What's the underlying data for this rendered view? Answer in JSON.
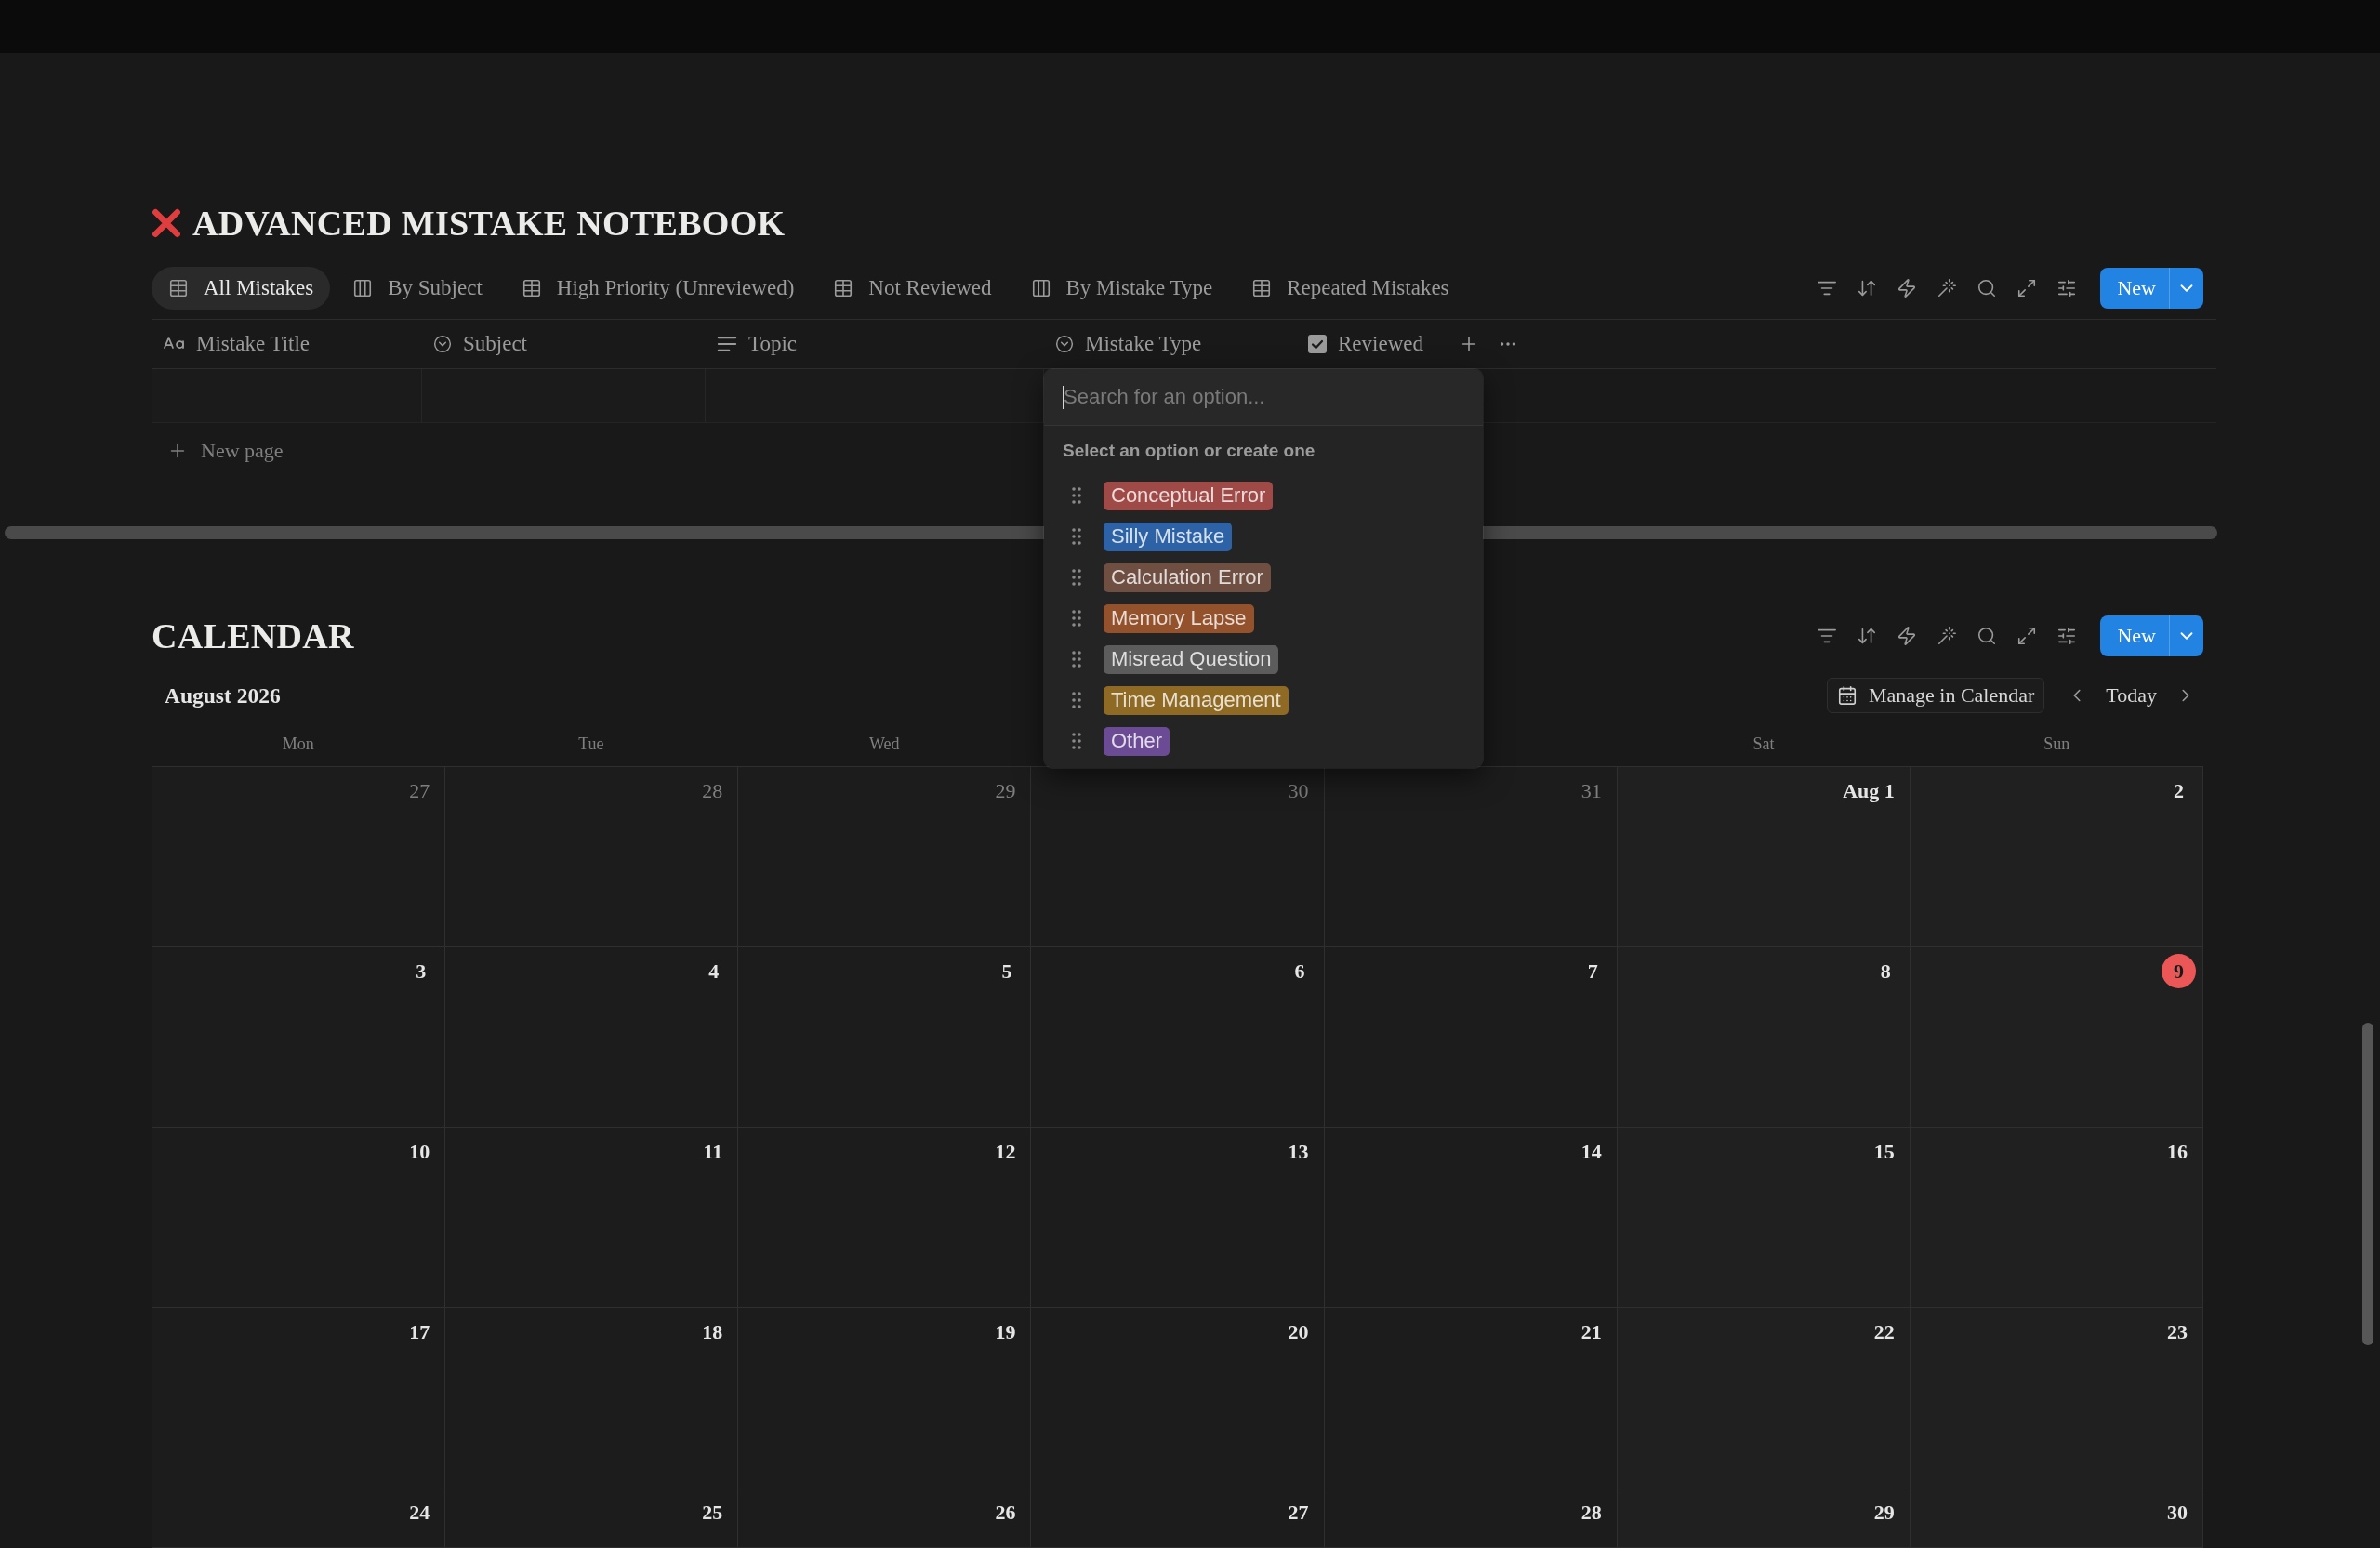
{
  "notebook": {
    "title": "ADVANCED MISTAKE NOTEBOOK",
    "views": [
      {
        "label": "All Mistakes",
        "kind": "table",
        "selected": true
      },
      {
        "label": "By Subject",
        "kind": "board",
        "selected": false
      },
      {
        "label": "High Priority (Unreviewed)",
        "kind": "table",
        "selected": false
      },
      {
        "label": "Not Reviewed",
        "kind": "table",
        "selected": false
      },
      {
        "label": "By Mistake Type",
        "kind": "board",
        "selected": false
      },
      {
        "label": "Repeated Mistakes",
        "kind": "table",
        "selected": false
      }
    ],
    "new_button": "New",
    "columns": [
      {
        "label": "Mistake Title",
        "kind": "title"
      },
      {
        "label": "Subject",
        "kind": "select"
      },
      {
        "label": "Topic",
        "kind": "text"
      },
      {
        "label": "Mistake Type",
        "kind": "select"
      },
      {
        "label": "Reviewed",
        "kind": "checkbox"
      }
    ],
    "new_page": "New page"
  },
  "option_menu": {
    "placeholder": "Search for an option...",
    "hint": "Select an option or create one",
    "options": [
      {
        "label": "Conceptual Error",
        "color": "#9f4a47"
      },
      {
        "label": "Silly Mistake",
        "color": "#2d63a6"
      },
      {
        "label": "Calculation Error",
        "color": "#6f4f42"
      },
      {
        "label": "Memory Lapse",
        "color": "#93512c"
      },
      {
        "label": "Misread Question",
        "color": "#5c5c5c"
      },
      {
        "label": "Time Management",
        "color": "#8e6a24"
      },
      {
        "label": "Other",
        "color": "#6b4b94"
      }
    ]
  },
  "calendar": {
    "title": "CALENDAR",
    "new_button": "New",
    "month": "August 2026",
    "manage_button": "Manage in Calendar",
    "today_button": "Today",
    "weekdays": {
      "mon": "Mon",
      "tue": "Tue",
      "wed": "Wed",
      "sat": "Sat",
      "sun": "Sun"
    },
    "weeks": [
      [
        {
          "label": "27",
          "in_month": false,
          "today": false
        },
        {
          "label": "28",
          "in_month": false,
          "today": false
        },
        {
          "label": "29",
          "in_month": false,
          "today": false
        },
        {
          "label": "30",
          "in_month": false,
          "today": false
        },
        {
          "label": "31",
          "in_month": false,
          "today": false
        },
        {
          "label": "Aug 1",
          "in_month": true,
          "today": false
        },
        {
          "label": "2",
          "in_month": true,
          "today": false
        }
      ],
      [
        {
          "label": "3",
          "in_month": true,
          "today": false
        },
        {
          "label": "4",
          "in_month": true,
          "today": false
        },
        {
          "label": "5",
          "in_month": true,
          "today": false
        },
        {
          "label": "6",
          "in_month": true,
          "today": false
        },
        {
          "label": "7",
          "in_month": true,
          "today": false
        },
        {
          "label": "8",
          "in_month": true,
          "today": false
        },
        {
          "label": "9",
          "in_month": true,
          "today": true
        }
      ],
      [
        {
          "label": "10",
          "in_month": true,
          "today": false
        },
        {
          "label": "11",
          "in_month": true,
          "today": false
        },
        {
          "label": "12",
          "in_month": true,
          "today": false
        },
        {
          "label": "13",
          "in_month": true,
          "today": false
        },
        {
          "label": "14",
          "in_month": true,
          "today": false
        },
        {
          "label": "15",
          "in_month": true,
          "today": false
        },
        {
          "label": "16",
          "in_month": true,
          "today": false
        }
      ],
      [
        {
          "label": "17",
          "in_month": true,
          "today": false
        },
        {
          "label": "18",
          "in_month": true,
          "today": false
        },
        {
          "label": "19",
          "in_month": true,
          "today": false
        },
        {
          "label": "20",
          "in_month": true,
          "today": false
        },
        {
          "label": "21",
          "in_month": true,
          "today": false
        },
        {
          "label": "22",
          "in_month": true,
          "today": false
        },
        {
          "label": "23",
          "in_month": true,
          "today": false
        }
      ],
      [
        {
          "label": "24",
          "in_month": true,
          "today": false
        },
        {
          "label": "25",
          "in_month": true,
          "today": false
        },
        {
          "label": "26",
          "in_month": true,
          "today": false
        },
        {
          "label": "27",
          "in_month": true,
          "today": false
        },
        {
          "label": "28",
          "in_month": true,
          "today": false
        },
        {
          "label": "29",
          "in_month": true,
          "today": false
        },
        {
          "label": "30",
          "in_month": true,
          "today": false
        }
      ]
    ]
  }
}
